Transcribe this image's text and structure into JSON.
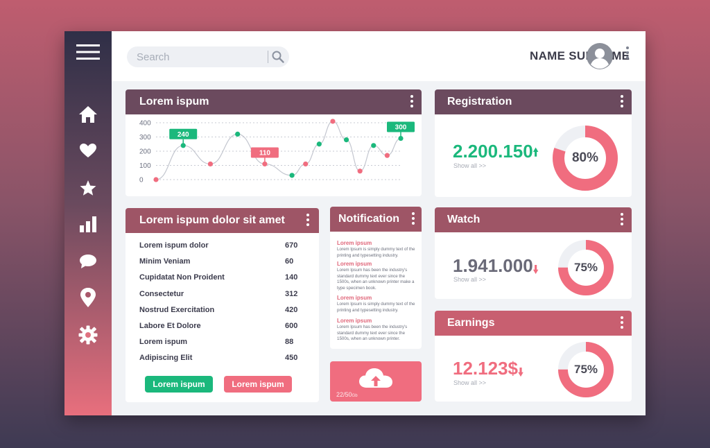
{
  "search": {
    "placeholder": "Search"
  },
  "user": {
    "name": "NAME SURNAME"
  },
  "colors": {
    "green": "#1bb87c",
    "pink": "#f06d7f",
    "header_dark": "#6b4a5e",
    "header_mid": "#9e5566",
    "header_pink": "#c85f70",
    "text_dark": "#3b3b4c"
  },
  "sidebar": {
    "items": [
      {
        "icon": "home-icon"
      },
      {
        "icon": "heart-icon"
      },
      {
        "icon": "star-icon"
      },
      {
        "icon": "bar-chart-icon"
      },
      {
        "icon": "chat-icon"
      },
      {
        "icon": "location-icon"
      },
      {
        "icon": "gear-icon"
      }
    ]
  },
  "chart_card": {
    "title": "Lorem ispum"
  },
  "chart_data": {
    "type": "line",
    "yticks": [
      400,
      300,
      200,
      100,
      0
    ],
    "ylim": [
      0,
      400
    ],
    "points": [
      {
        "x": 0,
        "y": 0,
        "color": "pink"
      },
      {
        "x": 1,
        "y": 240,
        "color": "green"
      },
      {
        "x": 2,
        "y": 110,
        "color": "pink"
      },
      {
        "x": 3,
        "y": 320,
        "color": "green"
      },
      {
        "x": 4,
        "y": 110,
        "color": "pink"
      },
      {
        "x": 5,
        "y": 30,
        "color": "green"
      },
      {
        "x": 5.5,
        "y": 110,
        "color": "pink"
      },
      {
        "x": 6,
        "y": 250,
        "color": "green"
      },
      {
        "x": 6.5,
        "y": 410,
        "color": "pink"
      },
      {
        "x": 7,
        "y": 280,
        "color": "green"
      },
      {
        "x": 7.5,
        "y": 60,
        "color": "pink"
      },
      {
        "x": 8,
        "y": 240,
        "color": "green"
      },
      {
        "x": 8.5,
        "y": 170,
        "color": "pink"
      },
      {
        "x": 9,
        "y": 290,
        "color": "green"
      }
    ],
    "labels": [
      {
        "text": "240",
        "point": 1,
        "color": "green"
      },
      {
        "text": "110",
        "point": 4,
        "color": "pink"
      },
      {
        "text": "300",
        "point": 13,
        "color": "green"
      }
    ]
  },
  "list_card": {
    "title": "Lorem ispum dolor sit amet",
    "rows": [
      {
        "label": "Lorem ispum dolor",
        "value": "670"
      },
      {
        "label": "Minim Veniam",
        "value": "60"
      },
      {
        "label": "Cupidatat Non Proident",
        "value": "140"
      },
      {
        "label": "Consectetur",
        "value": "312"
      },
      {
        "label": "Nostrud Exercitation",
        "value": "420"
      },
      {
        "label": "Labore Et Dolore",
        "value": "600"
      },
      {
        "label": "Lorem ispum",
        "value": "88"
      },
      {
        "label": "Adipiscing Elit",
        "value": "450"
      }
    ],
    "btn_green": "Lorem ispum",
    "btn_pink": "Lorem ispum"
  },
  "notification": {
    "title": "Notification",
    "items": [
      {
        "title": "Lorem ipsum",
        "body": "Lorem Ipsum is simply dummy text of the printing and typesetting industry."
      },
      {
        "title": "Lorem ipsum",
        "body": "Lorem Ipsum has been the industry's standard dummy text ever since the 1500s, when an unknown printer make a type specimen book."
      },
      {
        "title": "Lorem ipsum",
        "body": "Lorem Ipsum is simply dummy text of the printing and typesetting industry."
      },
      {
        "title": "Lorem ipsum",
        "body": "Lorem Ipsum has been the industry's standard dummy text ever since the 1500s, when an unknown printer."
      }
    ]
  },
  "upload": {
    "progress_text": "22/50",
    "progress_unit": "Gb"
  },
  "registration": {
    "title": "Registration",
    "value": "2.200.150",
    "trend": "up",
    "sub": "Show all >>",
    "percent": 80,
    "percent_label": "80%"
  },
  "watch": {
    "title": "Watch",
    "value": "1.941.000",
    "trend": "down",
    "sub": "Show all >>",
    "percent": 75,
    "percent_label": "75%"
  },
  "earnings": {
    "title": "Earnings",
    "value": "12.123$",
    "trend": "down",
    "sub": "Show all >>",
    "percent": 75,
    "percent_label": "75%"
  }
}
